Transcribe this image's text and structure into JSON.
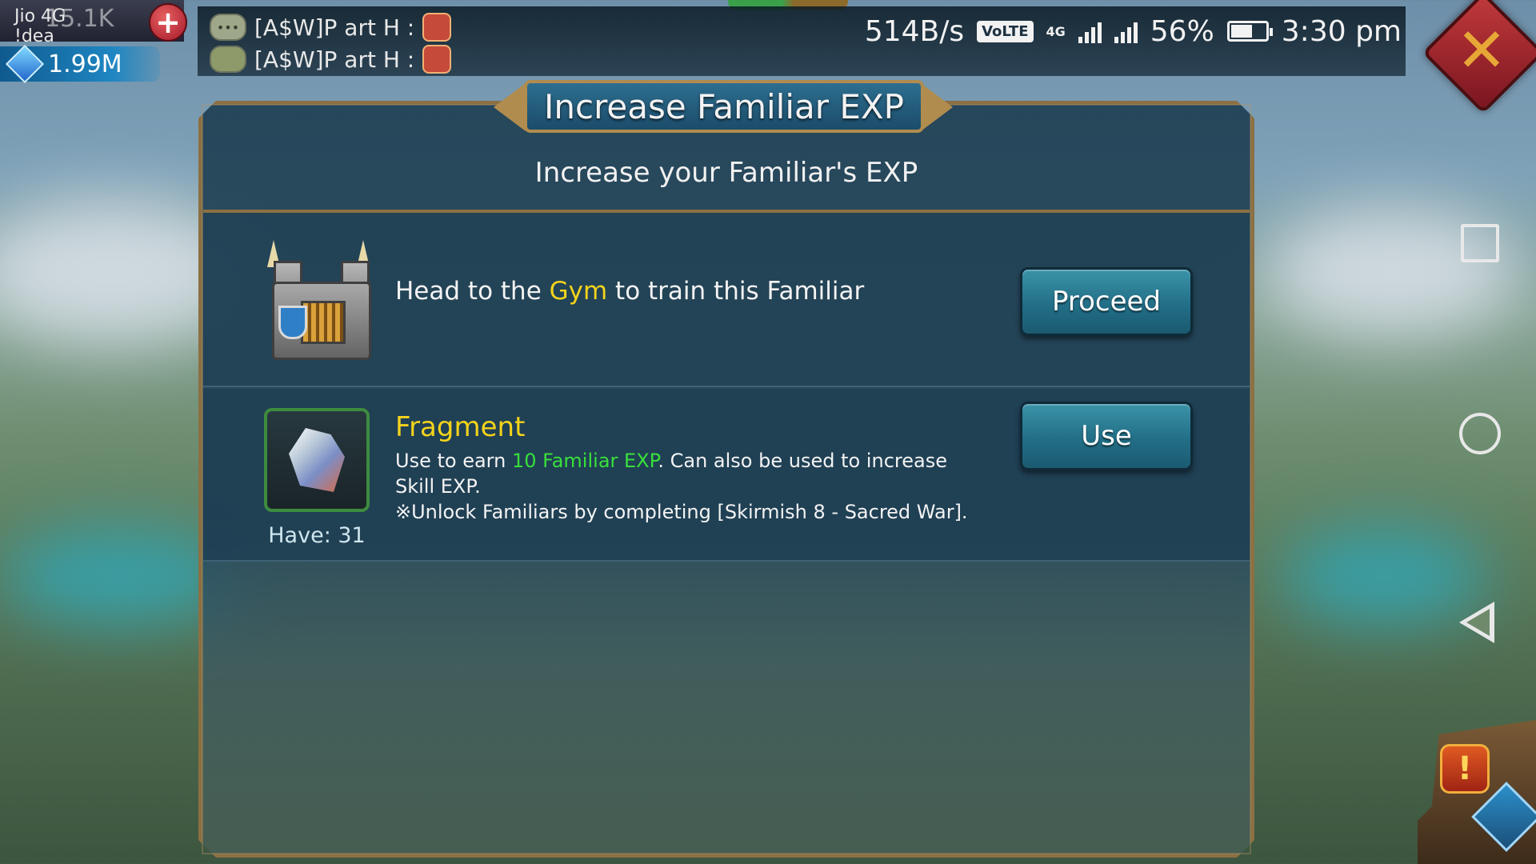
{
  "status": {
    "carrier_line1": "Jio 4G",
    "carrier_line2": "!dea",
    "power_value": "15.1K",
    "gems_value": "1.99M",
    "net_speed": "514B/s",
    "volte": "VoLTE",
    "network_4g": "4G",
    "battery_percent": "56%",
    "battery_level": 0.56,
    "time": "3:30 pm"
  },
  "chat": {
    "line1": "[A$W]P art H :",
    "line2": "[A$W]P art H :"
  },
  "dialog": {
    "title": "Increase Familiar EXP",
    "subtitle": "Increase your Familiar's EXP",
    "gym_row": {
      "text_before": "Head to the ",
      "highlight": "Gym",
      "text_after": " to train this Familiar",
      "button": "Proceed"
    },
    "fragment_row": {
      "title": "Fragment",
      "desc_before": "Use to earn ",
      "desc_highlight": "10 Familiar EXP",
      "desc_after": ". Can also be used to increase Skill EXP.",
      "note": "※Unlock Familiars by completing [Skirmish 8 - Sacred War].",
      "have": "Have: 31",
      "button": "Use"
    }
  },
  "colors": {
    "accent_yellow": "#f3d31b",
    "accent_green": "#39e03b",
    "frame_gold": "#8b7043",
    "button_teal": "#226f87"
  },
  "icons": {
    "close": "close-x-icon",
    "nav_recent": "square-icon",
    "nav_home": "circle-icon",
    "nav_back": "triangle-back-icon",
    "gem": "gem-icon",
    "gym": "gym-building-icon",
    "fragment": "fragment-crystal-icon"
  }
}
